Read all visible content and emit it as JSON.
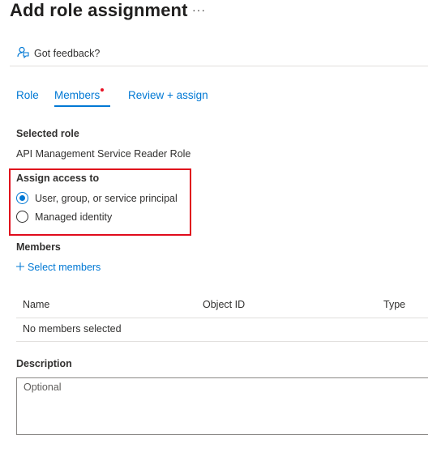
{
  "header": {
    "title": "Add role assignment",
    "more_label": "···"
  },
  "feedback": {
    "label": "Got feedback?",
    "icon": "feedback-icon"
  },
  "tabs": [
    {
      "label": "Role",
      "active": false
    },
    {
      "label": "Members",
      "active": true,
      "has_indicator": true
    },
    {
      "label": "Review + assign",
      "active": false
    }
  ],
  "selected_role": {
    "heading": "Selected role",
    "value": "API Management Service Reader Role"
  },
  "assign_access": {
    "heading": "Assign access to",
    "options": [
      {
        "label": "User, group, or service principal",
        "checked": true
      },
      {
        "label": "Managed identity",
        "checked": false
      }
    ]
  },
  "members": {
    "heading": "Members",
    "select_link": "Select members",
    "columns": [
      "Name",
      "Object ID",
      "Type"
    ],
    "empty_text": "No members selected"
  },
  "description": {
    "heading": "Description",
    "placeholder": "Optional",
    "value": ""
  },
  "colors": {
    "accent": "#0078d4",
    "highlight_border": "#e00b1c",
    "indicator": "#e81123"
  }
}
